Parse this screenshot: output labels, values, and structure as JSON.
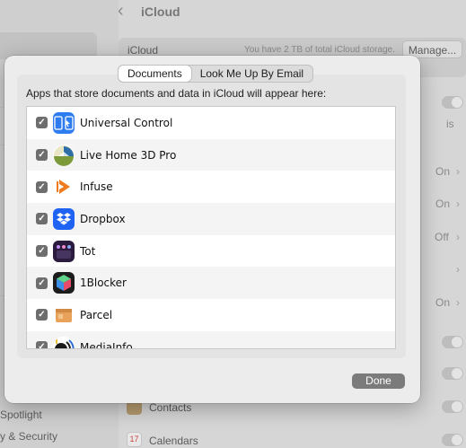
{
  "window": {
    "back_glyph": "‹",
    "title": "iCloud"
  },
  "sidebar": {
    "items": [
      {
        "label": "Spotlight"
      },
      {
        "label": "y & Security"
      }
    ]
  },
  "icloud_section": {
    "label": "iCloud",
    "storage_text": "You have 2 TB of total iCloud storage.",
    "manage_label": "Manage..."
  },
  "settings_rows": [
    {
      "value": "On"
    },
    {
      "value": "On"
    },
    {
      "value": "Off"
    },
    {
      "value": "On"
    },
    {
      "label": "Contacts"
    },
    {
      "label": "Calendars"
    }
  ],
  "partial_text": "is",
  "sheet": {
    "tabs": [
      {
        "label": "Documents",
        "active": true
      },
      {
        "label": "Look Me Up By Email",
        "active": false
      }
    ],
    "description": "Apps that store documents and data in iCloud will appear here:",
    "apps": [
      {
        "name": "Universal Control",
        "checked": true,
        "icon": "universal-control-icon"
      },
      {
        "name": "Live Home 3D Pro",
        "checked": true,
        "icon": "live-home-3d-icon"
      },
      {
        "name": "Infuse",
        "checked": true,
        "icon": "infuse-icon"
      },
      {
        "name": "Dropbox",
        "checked": true,
        "icon": "dropbox-icon"
      },
      {
        "name": "Tot",
        "checked": true,
        "icon": "tot-icon"
      },
      {
        "name": "1Blocker",
        "checked": true,
        "icon": "oneblocker-icon"
      },
      {
        "name": "Parcel",
        "checked": true,
        "icon": "parcel-icon"
      },
      {
        "name": "MediaInfo",
        "checked": true,
        "icon": "mediainfo-icon"
      }
    ],
    "done_label": "Done"
  },
  "colors": {
    "checkbox": "#6e6e6e",
    "done_button": "#7b7b7b",
    "dropbox_blue": "#1f63f5",
    "infuse_orange": "#f07a1e",
    "universal_blue": "#2f7cf0"
  }
}
